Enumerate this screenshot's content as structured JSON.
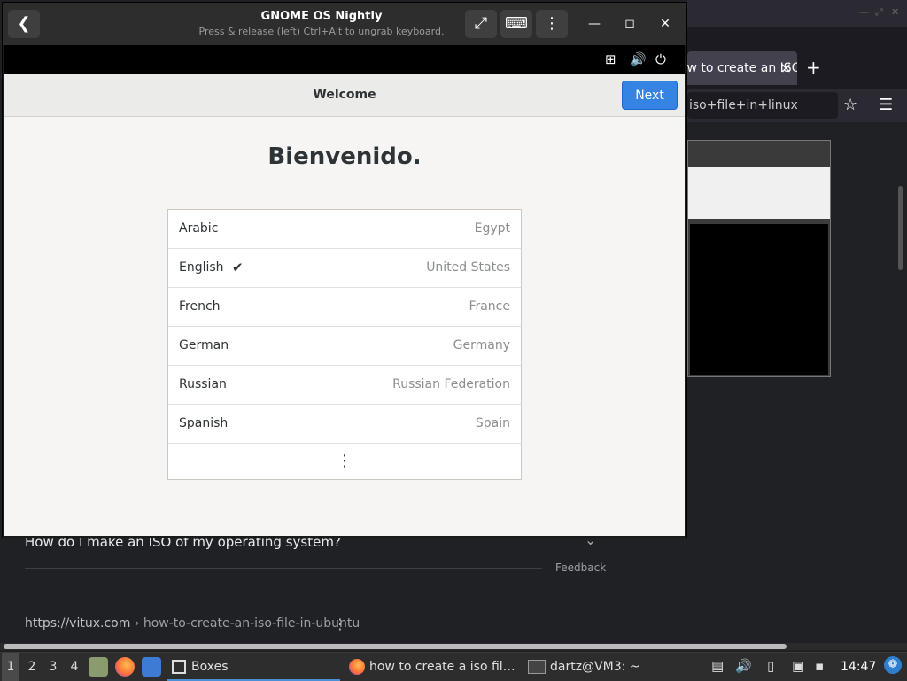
{
  "browser": {
    "tab_title": "how to create an ISO File",
    "tab_close": "×",
    "new_tab": "+",
    "url_text": "iso+file+in+linux",
    "star": "☆",
    "menu": "☰",
    "faq_question": "How do I make an ISO of my operating system?",
    "feedback": "Feedback",
    "cite_domain": "https://vitux.com",
    "cite_path": " › how-to-create-an-iso-file-in-ubuntu",
    "cite_menu": "⋮"
  },
  "boxes": {
    "title": "GNOME OS Nightly",
    "subtitle": "Press & release (left) Ctrl+Alt to ungrab keyboard.",
    "back": "❮",
    "fullscreen": "⤢",
    "keyboard": "⌨",
    "menu": "⋮",
    "minimize": "—",
    "maximize": "◻",
    "close": "✕"
  },
  "guest_topbar": {
    "network": "⊞",
    "volume": "🔊",
    "power": "⏻"
  },
  "guest": {
    "header_title": "Welcome",
    "next_label": "Next",
    "welcome_heading": "Bienvenido.",
    "languages": [
      {
        "language": "Arabic",
        "country": "Egypt",
        "selected": false
      },
      {
        "language": "English",
        "country": "United States",
        "selected": true
      },
      {
        "language": "French",
        "country": "France",
        "selected": false
      },
      {
        "language": "German",
        "country": "Germany",
        "selected": false
      },
      {
        "language": "Russian",
        "country": "Russian Federation",
        "selected": false
      },
      {
        "language": "Spanish",
        "country": "Spain",
        "selected": false
      }
    ],
    "check_mark": "✔",
    "more": "⋮"
  },
  "taskbar": {
    "workspaces": [
      "1",
      "2",
      "3",
      "4"
    ],
    "active_workspace": "1",
    "tasks": {
      "boxes": "Boxes",
      "firefox": "how to create a iso fil…",
      "terminal": "dartz@VM3: ~"
    },
    "clock": "14:47"
  }
}
